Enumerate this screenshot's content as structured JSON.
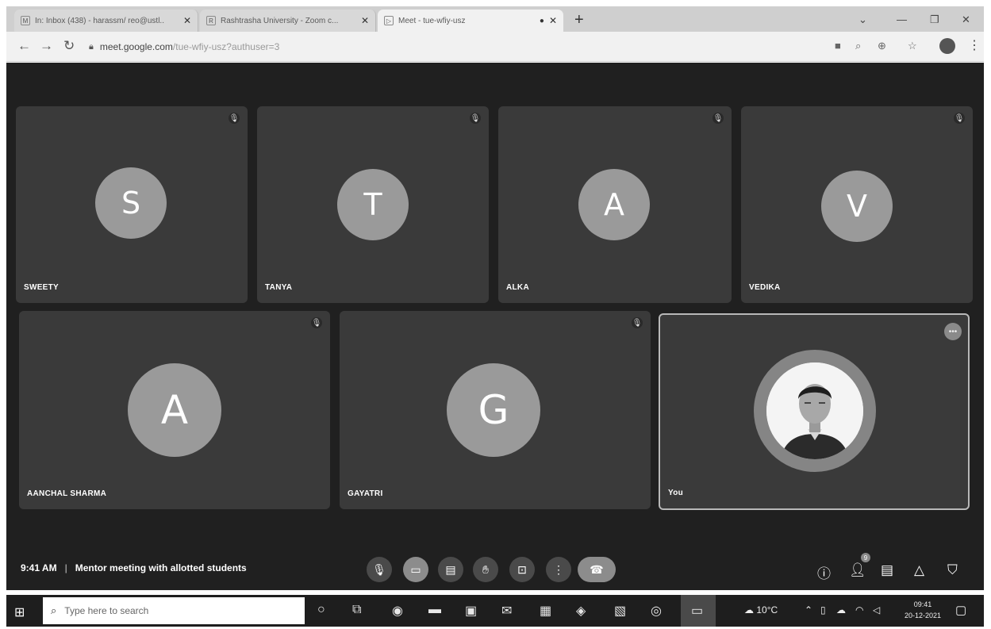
{
  "browser": {
    "tabs": [
      {
        "title": "In: Inbox (438) - harassm/ reo@ustl..",
        "favicon": "M",
        "active": false
      },
      {
        "title": "Rashtrasha University - Zoom c...",
        "favicon": "R",
        "active": false
      },
      {
        "title": "Meet - tue-wfiy-usz",
        "favicon": "▷",
        "active": true
      }
    ],
    "new_tab_label": "+",
    "url_host": "meet.google.com",
    "url_path": "/tue-wfiy-usz?authuser=3"
  },
  "meeting": {
    "time": "9:41 AM",
    "title": "Mentor meeting with allotted students",
    "participants": [
      {
        "initial": "S",
        "name": "SWEETY"
      },
      {
        "initial": "T",
        "name": "TANYA"
      },
      {
        "initial": "A",
        "name": "ALKA"
      },
      {
        "initial": "V",
        "name": "VEDIKA"
      },
      {
        "initial": "A",
        "name": "AANCHAL SHARMA"
      },
      {
        "initial": "G",
        "name": "GAYATRI"
      }
    ],
    "self": {
      "name": "You"
    },
    "people_count": "9"
  },
  "taskbar": {
    "search_placeholder": "Type here to search",
    "weather": "10°C",
    "time": "09:41",
    "date": "20-12-2021"
  },
  "colors": {
    "stage_bg": "#202020",
    "tile_bg": "#3a3a3a",
    "avatar_bg": "#9a9a9a"
  }
}
